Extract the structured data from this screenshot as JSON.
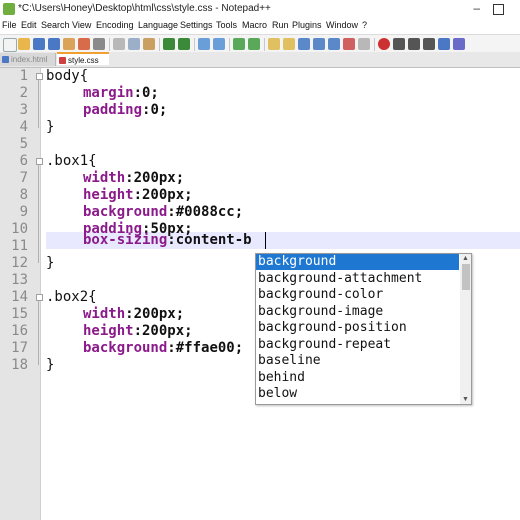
{
  "window": {
    "title": "*C:\\Users\\Honey\\Desktop\\html\\css\\style.css - Notepad++",
    "minimize": "–"
  },
  "menu": [
    "File",
    "Edit",
    "Search",
    "View",
    "Encoding",
    "Language",
    "Settings",
    "Tools",
    "Macro",
    "Run",
    "Plugins",
    "Window",
    "?"
  ],
  "tabs": [
    {
      "label": "index.html",
      "active": false
    },
    {
      "label": "style.css",
      "active": true
    }
  ],
  "editor": {
    "line_numbers": [
      "1",
      "2",
      "3",
      "4",
      "5",
      "6",
      "7",
      "8",
      "9",
      "10",
      "11",
      "12",
      "13",
      "14",
      "15",
      "16",
      "17",
      "18"
    ],
    "lines": {
      "l1_sel": "body",
      "l1_brace": "{",
      "l2_prop": "margin",
      "l2_val": ":0;",
      "l3_prop": "padding",
      "l3_val": ":0;",
      "l4": "}",
      "l6_sel": ".box1",
      "l6_brace": "{",
      "l7_prop": "width",
      "l7_val": ":200px;",
      "l8_prop": "height",
      "l8_val": ":200px;",
      "l9_prop": "background",
      "l9_val": ":#0088cc;",
      "l10_prop": "padding",
      "l10_val": ":50px;",
      "l11_prop": "box-sizing",
      "l11_val": ":content-b",
      "l12": "}",
      "l14_sel": ".box2",
      "l14_brace": "{",
      "l15_prop": "width",
      "l15_val": ":200px;",
      "l16_prop": "height",
      "l16_val": ":200px;",
      "l17_prop": "background",
      "l17_val": ":#ffae00;",
      "l18": "}"
    }
  },
  "autocomplete": {
    "items": [
      "background",
      "background-attachment",
      "background-color",
      "background-image",
      "background-position",
      "background-repeat",
      "baseline",
      "behind",
      "below"
    ],
    "selected_index": 0
  },
  "colors": {
    "property": "#8b1a8b",
    "selection": "#1e78d2",
    "tab_accent": "#f0a030",
    "current_line": "#e8e8ff"
  }
}
